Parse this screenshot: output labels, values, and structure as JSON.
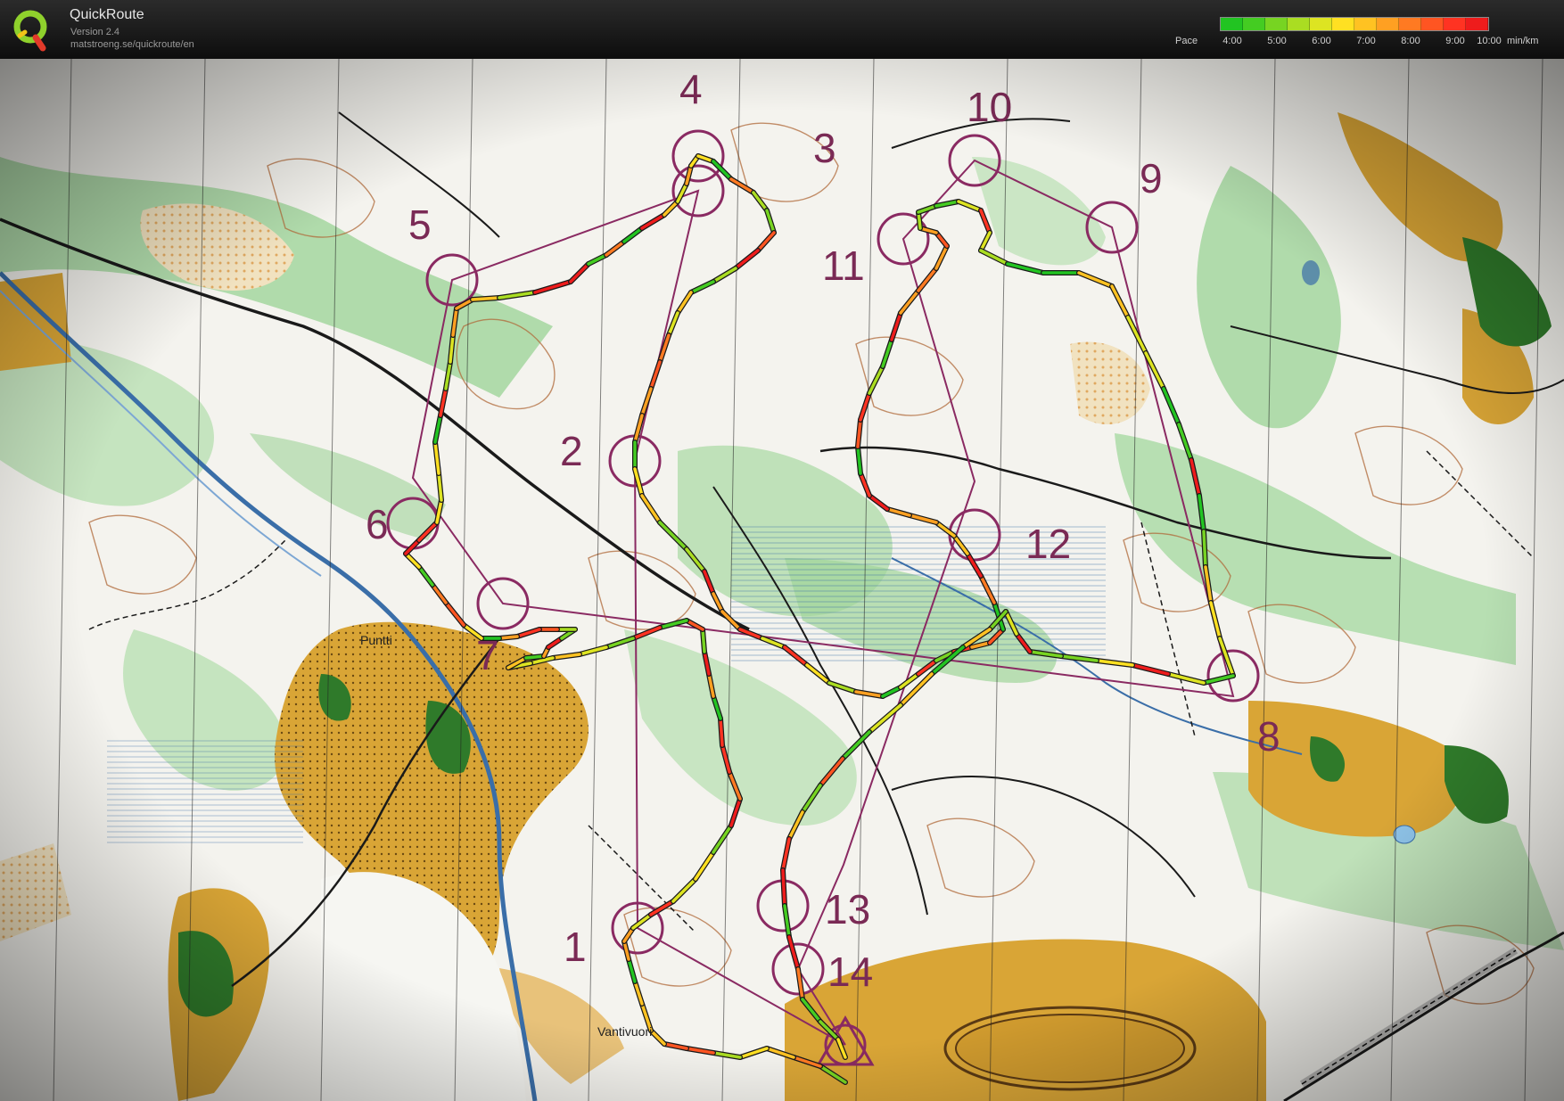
{
  "app": {
    "title": "QuickRoute",
    "version": "Version 2.4",
    "url": "matstroeng.se/quickroute/en"
  },
  "legend": {
    "label": "Pace",
    "ticks": [
      "4:00",
      "5:00",
      "6:00",
      "7:00",
      "8:00",
      "9:00",
      "10:00"
    ],
    "unit": "min/km",
    "colors": [
      "#22c422",
      "#44cc22",
      "#77d422",
      "#aadd22",
      "#dde422",
      "#ffe022",
      "#ffc222",
      "#ffa022",
      "#ff7a22",
      "#ff5522",
      "#ff3322",
      "#ee1c1c"
    ]
  },
  "map": {
    "place_names": [
      "Puntti",
      "Vantivuori"
    ],
    "controls": [
      {
        "number": "1"
      },
      {
        "number": "2"
      },
      {
        "number": "3"
      },
      {
        "number": "4"
      },
      {
        "number": "5"
      },
      {
        "number": "6"
      },
      {
        "number": "7"
      },
      {
        "number": "8"
      },
      {
        "number": "9"
      },
      {
        "number": "10"
      },
      {
        "number": "11"
      },
      {
        "number": "12"
      },
      {
        "number": "13"
      },
      {
        "number": "14"
      }
    ],
    "colors": {
      "course": "#8a2a62",
      "open_land": "#d9a536",
      "forest_green": "#9fd49a",
      "dark_green": "#2f7a2a",
      "water": "#3a6ea8",
      "contour": "#b06a3a"
    }
  }
}
